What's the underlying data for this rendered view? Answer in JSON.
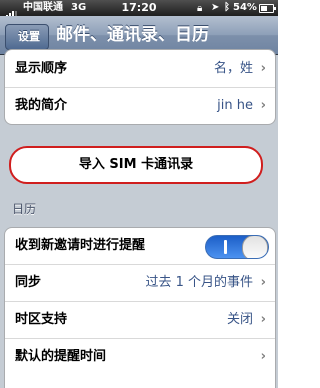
{
  "status_bar": {
    "carrier": "中国联通",
    "network": "3G",
    "time": "17:20",
    "battery_pct": "54%",
    "battery_level": 0.54,
    "icons": [
      "signal-icon",
      "lock-icon",
      "location-arrow-icon",
      "bluetooth-icon",
      "battery-icon"
    ]
  },
  "nav": {
    "back_label": "设置",
    "title": "邮件、通讯录、日历"
  },
  "contacts": {
    "display_order_label": "显示顺序",
    "display_order_value": "名，姓",
    "my_info_label": "我的简介",
    "my_info_value": "jin he"
  },
  "import_sim_label": "导入 SIM 卡通讯录",
  "calendar": {
    "header": "日历",
    "new_invite_alerts_label": "收到新邀请时进行提醒",
    "new_invite_alerts_on": true,
    "sync_label": "同步",
    "sync_value": "过去 1 个月的事件",
    "timezone_label": "时区支持",
    "timezone_value": "关闭",
    "default_alert_label": "默认的提醒时间"
  },
  "colors": {
    "accent_red": "#d01e1e",
    "toggle_blue": "#2a6fd6",
    "value_blue": "#385487"
  }
}
